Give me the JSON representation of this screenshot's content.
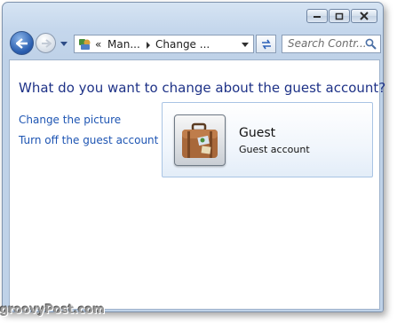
{
  "address_bar": {
    "overflow": "«",
    "segments": [
      "Man...",
      "Change ..."
    ]
  },
  "search": {
    "placeholder": "Search Contr..."
  },
  "page": {
    "heading": "What do you want to change about the guest account?",
    "tasks": [
      "Change the picture",
      "Turn off the guest account"
    ]
  },
  "account": {
    "name": "Guest",
    "type": "Guest account",
    "picture": "suitcase-icon"
  },
  "watermark": "groovyPost.com",
  "colors": {
    "heading": "#1e3287",
    "link": "#1e55b3",
    "frame": "#bfd2e8"
  }
}
